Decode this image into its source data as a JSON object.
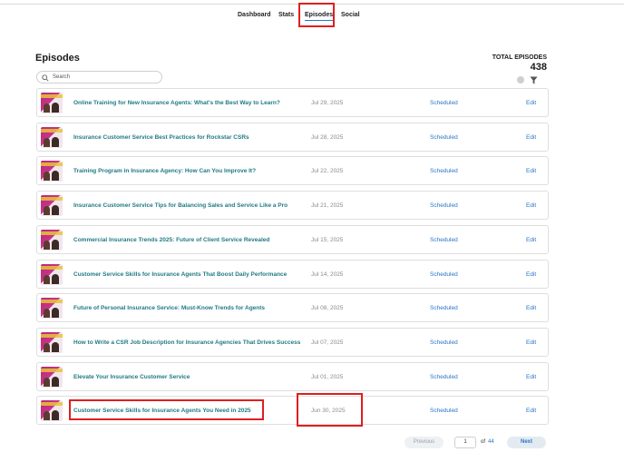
{
  "nav": {
    "tabs": [
      {
        "label": "Dashboard"
      },
      {
        "label": "Stats"
      },
      {
        "label": "Episodes"
      },
      {
        "label": "Social"
      }
    ]
  },
  "page": {
    "title": "Episodes",
    "total_label": "TOTAL EPISODES",
    "total_value": "438"
  },
  "search": {
    "placeholder": "Search"
  },
  "episodes": [
    {
      "title": "Online Training for New Insurance Agents: What's the Best Way to Learn?",
      "date": "Jul 29, 2025",
      "status": "Scheduled",
      "action": "Edit"
    },
    {
      "title": "Insurance Customer Service Best Practices for Rockstar CSRs",
      "date": "Jul 28, 2025",
      "status": "Scheduled",
      "action": "Edit"
    },
    {
      "title": "Training Program in Insurance Agency: How Can You Improve It?",
      "date": "Jul 22, 2025",
      "status": "Scheduled",
      "action": "Edit"
    },
    {
      "title": "Insurance Customer Service Tips for Balancing Sales and Service Like a Pro",
      "date": "Jul 21, 2025",
      "status": "Scheduled",
      "action": "Edit"
    },
    {
      "title": "Commercial Insurance Trends 2025: Future of Client Service Revealed",
      "date": "Jul 15, 2025",
      "status": "Scheduled",
      "action": "Edit"
    },
    {
      "title": "Customer Service Skills for Insurance Agents That Boost Daily Performance",
      "date": "Jul 14, 2025",
      "status": "Scheduled",
      "action": "Edit"
    },
    {
      "title": "Future of Personal Insurance Service: Must-Know Trends for Agents",
      "date": "Jul 08, 2025",
      "status": "Scheduled",
      "action": "Edit"
    },
    {
      "title": "How to Write a CSR Job Description for Insurance Agencies That Drives Success",
      "date": "Jul 07, 2025",
      "status": "Scheduled",
      "action": "Edit"
    },
    {
      "title": "Elevate Your Insurance Customer Service",
      "date": "Jul 01, 2025",
      "status": "Scheduled",
      "action": "Edit"
    },
    {
      "title": "Customer Service Skills for Insurance Agents You Need in 2025",
      "date": "Jun 30, 2025",
      "status": "Scheduled",
      "action": "Edit"
    }
  ],
  "pagination": {
    "previous": "Previous",
    "current_page": "1",
    "of": "of",
    "total_pages": "44",
    "next": "Next"
  },
  "icons": {
    "search": "search-icon",
    "check": "check-circle-icon",
    "filter": "filter-icon"
  },
  "colors": {
    "accent": "#2a74c9",
    "title_link": "#1f7a84",
    "annotation": "#e01e1e"
  }
}
